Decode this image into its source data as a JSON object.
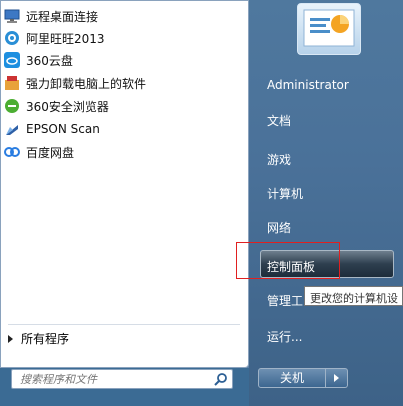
{
  "programs": [
    {
      "label": "远程桌面连接",
      "icon": "remote-desktop-icon"
    },
    {
      "label": "阿里旺旺2013",
      "icon": "aliwangwang-icon"
    },
    {
      "label": "360云盘",
      "icon": "cloud-icon"
    },
    {
      "label": "强力卸载电脑上的软件",
      "icon": "uninstall-icon"
    },
    {
      "label": "360安全浏览器",
      "icon": "browser-icon"
    },
    {
      "label": "EPSON Scan",
      "icon": "scanner-icon"
    },
    {
      "label": "百度网盘",
      "icon": "baidu-netdisk-icon"
    }
  ],
  "all_programs": "所有程序",
  "search": {
    "placeholder": "搜索程序和文件",
    "icon": "search-icon"
  },
  "right_menu": {
    "user": "Administrator",
    "documents": "文档",
    "games": "游戏",
    "computer": "计算机",
    "network": "网络",
    "control_panel": "控制面板",
    "admin_tools": "管理工",
    "run": "运行..."
  },
  "tooltip": "更改您的计算机设",
  "shutdown": {
    "label": "关机"
  },
  "colors": {
    "highlight": "#e02020",
    "panel": "#4a7199"
  }
}
